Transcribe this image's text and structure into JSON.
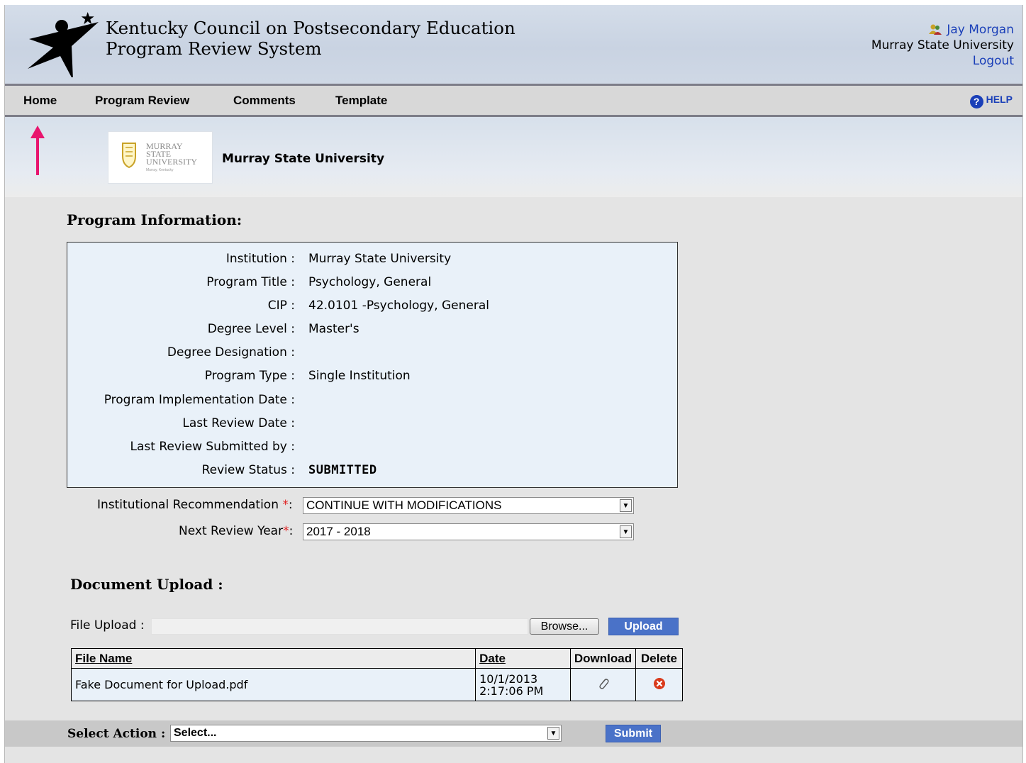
{
  "header": {
    "title_line1": "Kentucky Council on Postsecondary Education",
    "title_line2": "Program Review System",
    "user_name": "Jay Morgan",
    "user_org": "Murray State University",
    "logout": "Logout"
  },
  "nav": {
    "items": [
      {
        "label": "Home"
      },
      {
        "label": "Program Review"
      },
      {
        "label": "Comments"
      },
      {
        "label": "Template"
      }
    ],
    "help": "HELP"
  },
  "banner": {
    "logo_text": [
      "MURRAY",
      "STATE",
      "UNIVERSITY",
      "Murray, Kentucky"
    ],
    "university": "Murray State University"
  },
  "program_info": {
    "heading": "Program Information:",
    "rows": [
      {
        "label": "Institution :",
        "value": "Murray State University"
      },
      {
        "label": "Program Title :",
        "value": "Psychology, General"
      },
      {
        "label": "CIP :",
        "value": "42.0101 -Psychology, General"
      },
      {
        "label": "Degree Level :",
        "value": "Master's"
      },
      {
        "label": "Degree Designation :",
        "value": ""
      },
      {
        "label": "Program Type :",
        "value": "Single Institution"
      },
      {
        "label": "Program Implementation Date :",
        "value": ""
      },
      {
        "label": "Last Review Date :",
        "value": ""
      },
      {
        "label": "Last Review Submitted by :",
        "value": ""
      },
      {
        "label": "Review Status :",
        "value": "SUBMITTED"
      }
    ]
  },
  "recommendation": {
    "label": "Institutional Recommendation",
    "value": "CONTINUE WITH MODIFICATIONS"
  },
  "next_review": {
    "label": "Next Review Year",
    "value": "2017 - 2018"
  },
  "upload": {
    "heading": "Document Upload :",
    "file_label": "File Upload :",
    "browse": "Browse...",
    "upload_button": "Upload",
    "columns": [
      "File Name",
      "Date",
      "Download",
      "Delete"
    ],
    "files": [
      {
        "name": "Fake Document for Upload.pdf",
        "date_line1": "10/1/2013",
        "date_line2": "2:17:06 PM"
      }
    ]
  },
  "action": {
    "label": "Select Action :",
    "value": "Select...",
    "submit": "Submit"
  },
  "colors": {
    "link": "#1a3fb8",
    "button": "#4a72c8",
    "required": "#e02020",
    "annotation_arrow": "#e8156e"
  }
}
